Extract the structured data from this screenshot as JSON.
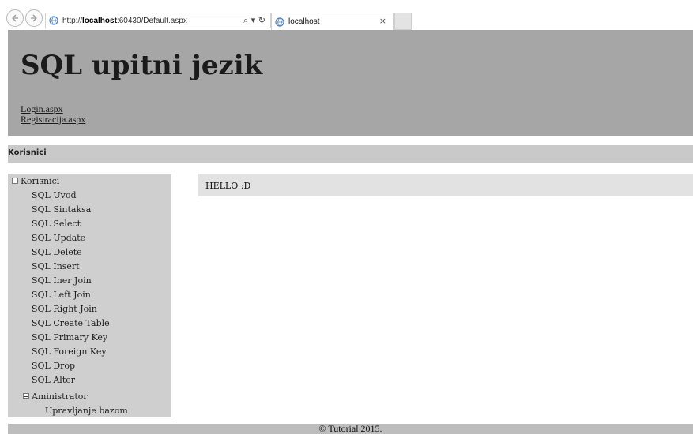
{
  "browser": {
    "url_prefix": "http://",
    "url_host": "localhost",
    "url_rest": ":60430/Default.aspx",
    "address_tools": "⌕ ▾ ↻",
    "tab_title": "localhost",
    "tab_close": "×"
  },
  "header": {
    "title": "SQL upitni jezik",
    "links": [
      "Login.aspx",
      "Registracija.aspx"
    ]
  },
  "breadcrumb": "Korisnici",
  "sidebar": {
    "root": "Korisnici",
    "items": [
      "SQL Uvod",
      "SQL Sintaksa",
      "SQL Select",
      "SQL Update",
      "SQL Delete",
      "SQL Insert",
      "SQL Iner Join",
      "SQL Left Join",
      "SQL Right Join",
      "SQL Create Table",
      "SQL Primary Key",
      "SQL Foreign Key",
      "SQL Drop",
      "SQL Alter"
    ],
    "sub_root": "Aministrator",
    "sub_items": [
      "Upravljanje bazom"
    ]
  },
  "content": {
    "message": "HELLO :D"
  },
  "footer": "© Tutorial 2015."
}
